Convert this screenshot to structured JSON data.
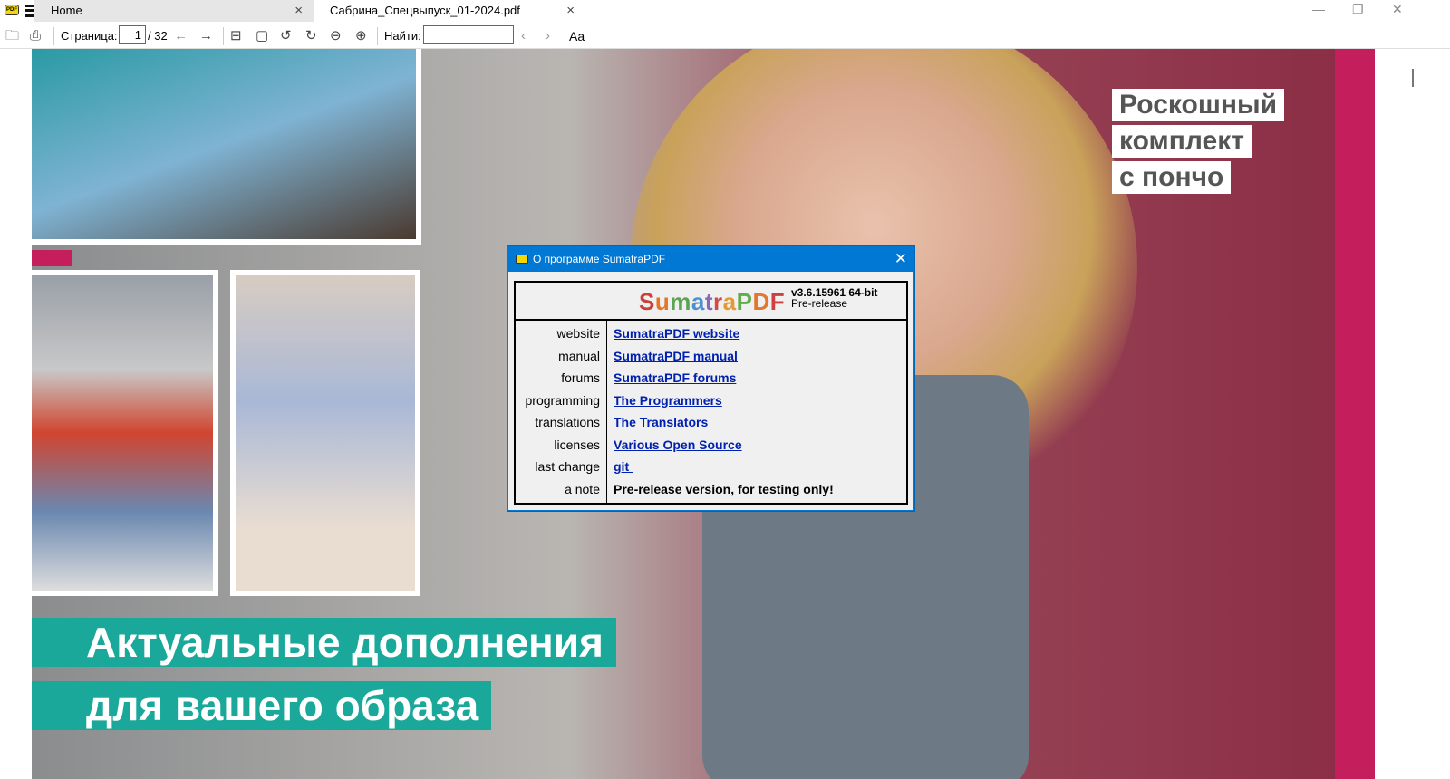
{
  "tabs": [
    {
      "label": "Home"
    },
    {
      "label": "Сабрина_Спецвыпуск_01-2024.pdf"
    }
  ],
  "toolbar": {
    "page_label": "Страница:",
    "page_value": "1",
    "page_total": "/ 32",
    "find_label": "Найти:",
    "find_value": "",
    "match_case": "Aa"
  },
  "page": {
    "headline": [
      "Роскошный",
      "комплект",
      "с пончо"
    ],
    "banner": [
      "Актуальные дополнения",
      "для вашего образа"
    ]
  },
  "dialog": {
    "title": "О программе SumatraPDF",
    "brand": "SumatraPDF",
    "version": "v3.6.15961 64-bit",
    "channel": "Pre-release",
    "rows": [
      {
        "k": "website",
        "v": "SumatraPDF website"
      },
      {
        "k": "manual",
        "v": "SumatraPDF manual"
      },
      {
        "k": "forums",
        "v": "SumatraPDF forums"
      },
      {
        "k": "programming",
        "v": "The Programmers"
      },
      {
        "k": "translations",
        "v": "The Translators"
      },
      {
        "k": "licenses",
        "v": "Various Open Source"
      },
      {
        "k": "last change",
        "v": "git "
      },
      {
        "k": "a note",
        "v": "Pre-release version, for testing only!"
      }
    ]
  },
  "colors": {
    "accent": "#0078d4",
    "link": "#0020b0",
    "teal": "#1aa89a",
    "magenta": "#c41e5c"
  }
}
